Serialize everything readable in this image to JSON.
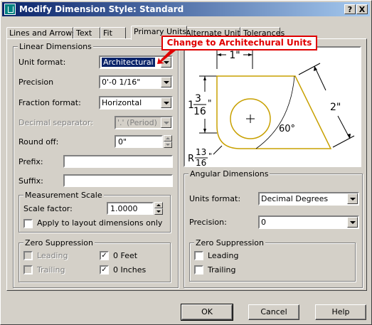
{
  "window": {
    "title": "Modify Dimension Style: Standard",
    "help_btn": "?",
    "close_btn": "X"
  },
  "tabs": [
    {
      "label": "Lines and Arrows"
    },
    {
      "label": "Text"
    },
    {
      "label": "Fit"
    },
    {
      "label": "Primary Units",
      "active": true
    },
    {
      "label": "Alternate Units"
    },
    {
      "label": "Tolerances"
    }
  ],
  "callout": {
    "text": "Change to Architechural Units",
    "color": "#e00000"
  },
  "linear": {
    "legend": "Linear Dimensions",
    "unit_format_label": "Unit format:",
    "unit_format_value": "Architectural",
    "precision_label": "Precision",
    "precision_value": "0'-0 1/16\"",
    "fraction_format_label": "Fraction format:",
    "fraction_format_value": "Horizontal",
    "decimal_sep_label": "Decimal separator:",
    "decimal_sep_value": "'.' (Period)",
    "round_off_label": "Round off:",
    "round_off_value": "0\"",
    "prefix_label": "Prefix:",
    "suffix_label": "Suffix:",
    "prefix_value": "",
    "suffix_value": ""
  },
  "measurement": {
    "legend": "Measurement Scale",
    "scale_label": "Scale factor:",
    "scale_value": "1.0000",
    "layout_label": "Apply to layout dimensions only",
    "layout_checked": false
  },
  "zero_linear": {
    "legend": "Zero Suppression",
    "leading_label": "Leading",
    "trailing_label": "Trailing",
    "feet_label": "0 Feet",
    "inches_label": "0 Inches",
    "leading_checked": false,
    "trailing_checked": false,
    "feet_checked": true,
    "inches_checked": true
  },
  "preview": {
    "dim_top": "1\"",
    "dim_left_whole": "1",
    "dim_left_num": "3",
    "dim_left_den": "16",
    "dim_right": "2\"",
    "dim_angle": "60°",
    "dim_radius_prefix": "R",
    "dim_radius_num": "13",
    "dim_radius_den": "16",
    "inch_mark": "\"",
    "shape_color": "#c8a000"
  },
  "angular": {
    "legend": "Angular Dimensions",
    "units_label": "Units format:",
    "units_value": "Decimal Degrees",
    "precision_label": "Precision:",
    "precision_value": "0"
  },
  "zero_angular": {
    "legend": "Zero Suppression",
    "leading_label": "Leading",
    "trailing_label": "Trailing",
    "leading_checked": false,
    "trailing_checked": false
  },
  "buttons": {
    "ok": "OK",
    "cancel": "Cancel",
    "help": "Help"
  }
}
